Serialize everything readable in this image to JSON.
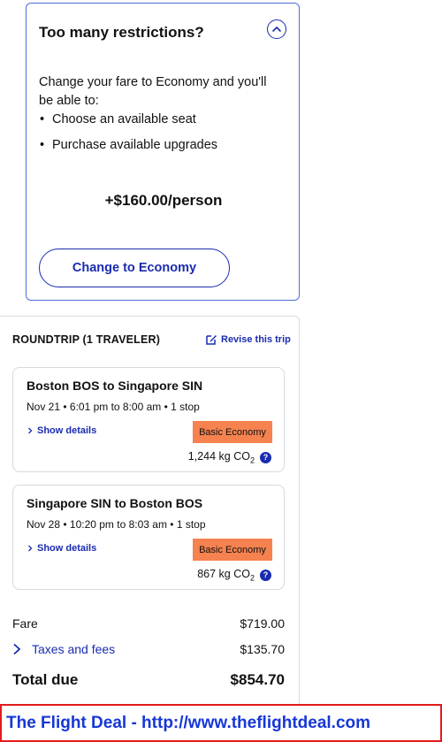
{
  "upsell": {
    "title": "Too many restrictions?",
    "intro": "Change your fare to Economy and you'll be able to:",
    "benefits": [
      "Choose an available seat",
      "Purchase available upgrades"
    ],
    "price": "+$160.00/person",
    "button_label": "Change to Economy",
    "collapse_icon": "chevron-up-icon"
  },
  "summary": {
    "trip_label": "ROUNDTRIP (1 TRAVELER)",
    "revise_label": "Revise this trip",
    "flights": [
      {
        "route": "Boston BOS to Singapore SIN",
        "details": "Nov 21 • 6:01 pm to 8:00 am • 1 stop",
        "show_details": "Show details",
        "fare_class": "Basic Economy",
        "co2_value": "1,244 kg CO",
        "co2_sub": "2"
      },
      {
        "route": "Singapore SIN to Boston BOS",
        "details": "Nov 28 • 10:20 pm to 8:03 am • 1 stop",
        "show_details": "Show details",
        "fare_class": "Basic Economy",
        "co2_value": "867 kg CO",
        "co2_sub": "2"
      }
    ],
    "fare_label": "Fare",
    "fare_value": "$719.00",
    "taxes_label": "Taxes and fees",
    "taxes_value": "$135.70",
    "total_label": "Total due",
    "total_value": "$854.70"
  },
  "banner": {
    "text": "The Flight Deal - http://www.theflightdeal.com"
  },
  "colors": {
    "accent": "#1a2bb0",
    "badge": "#f5824f",
    "banner_border": "#e41b1b",
    "banner_text": "#1737d6"
  }
}
